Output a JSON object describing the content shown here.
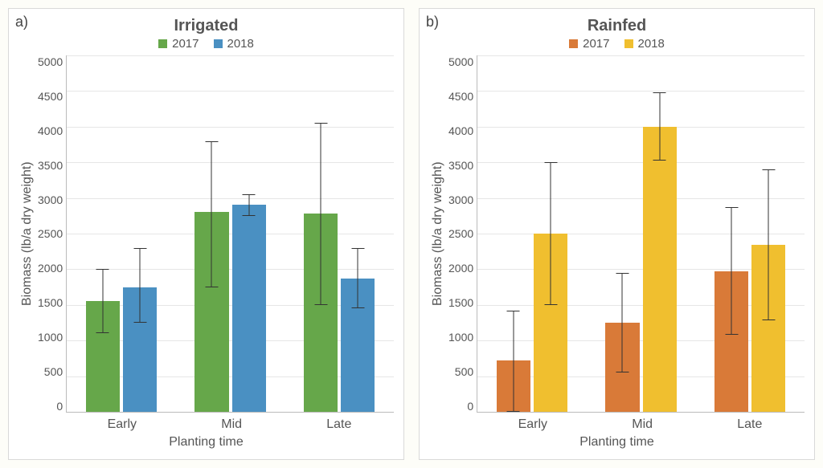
{
  "chart_data": [
    {
      "tag": "a)",
      "type": "bar",
      "title": "Irrigated",
      "xlabel": "Planting time",
      "ylabel": "Biomass (lb/a dry weight)",
      "ylim": [
        0,
        5000
      ],
      "yticks": [
        0,
        500,
        1000,
        1500,
        2000,
        2500,
        3000,
        3500,
        4000,
        4500,
        5000
      ],
      "categories": [
        "Early",
        "Mid",
        "Late"
      ],
      "series": [
        {
          "name": "2017",
          "color": "#66a74a",
          "values": [
            1550,
            2800,
            2780
          ],
          "err_low": [
            1100,
            1750,
            1500
          ],
          "err_high": [
            2000,
            3800,
            4050
          ]
        },
        {
          "name": "2018",
          "color": "#4a90c2",
          "values": [
            1750,
            2900,
            1870
          ],
          "err_low": [
            1250,
            2750,
            1450
          ],
          "err_high": [
            2300,
            3050,
            2300
          ]
        }
      ]
    },
    {
      "tag": "b)",
      "type": "bar",
      "title": "Rainfed",
      "xlabel": "Planting time",
      "ylabel": "Biomass (lb/a dry weight)",
      "ylim": [
        0,
        5000
      ],
      "yticks": [
        0,
        500,
        1000,
        1500,
        2000,
        2500,
        3000,
        3500,
        4000,
        4500,
        5000
      ],
      "categories": [
        "Early",
        "Mid",
        "Late"
      ],
      "series": [
        {
          "name": "2017",
          "color": "#d97a38",
          "values": [
            720,
            1250,
            1970
          ],
          "err_low": [
            0,
            550,
            1080
          ],
          "err_high": [
            1420,
            1950,
            2870
          ]
        },
        {
          "name": "2018",
          "color": "#f0bf2f",
          "values": [
            2500,
            4000,
            2340
          ],
          "err_low": [
            1500,
            3520,
            1280
          ],
          "err_high": [
            3500,
            4480,
            3400
          ]
        }
      ]
    }
  ]
}
